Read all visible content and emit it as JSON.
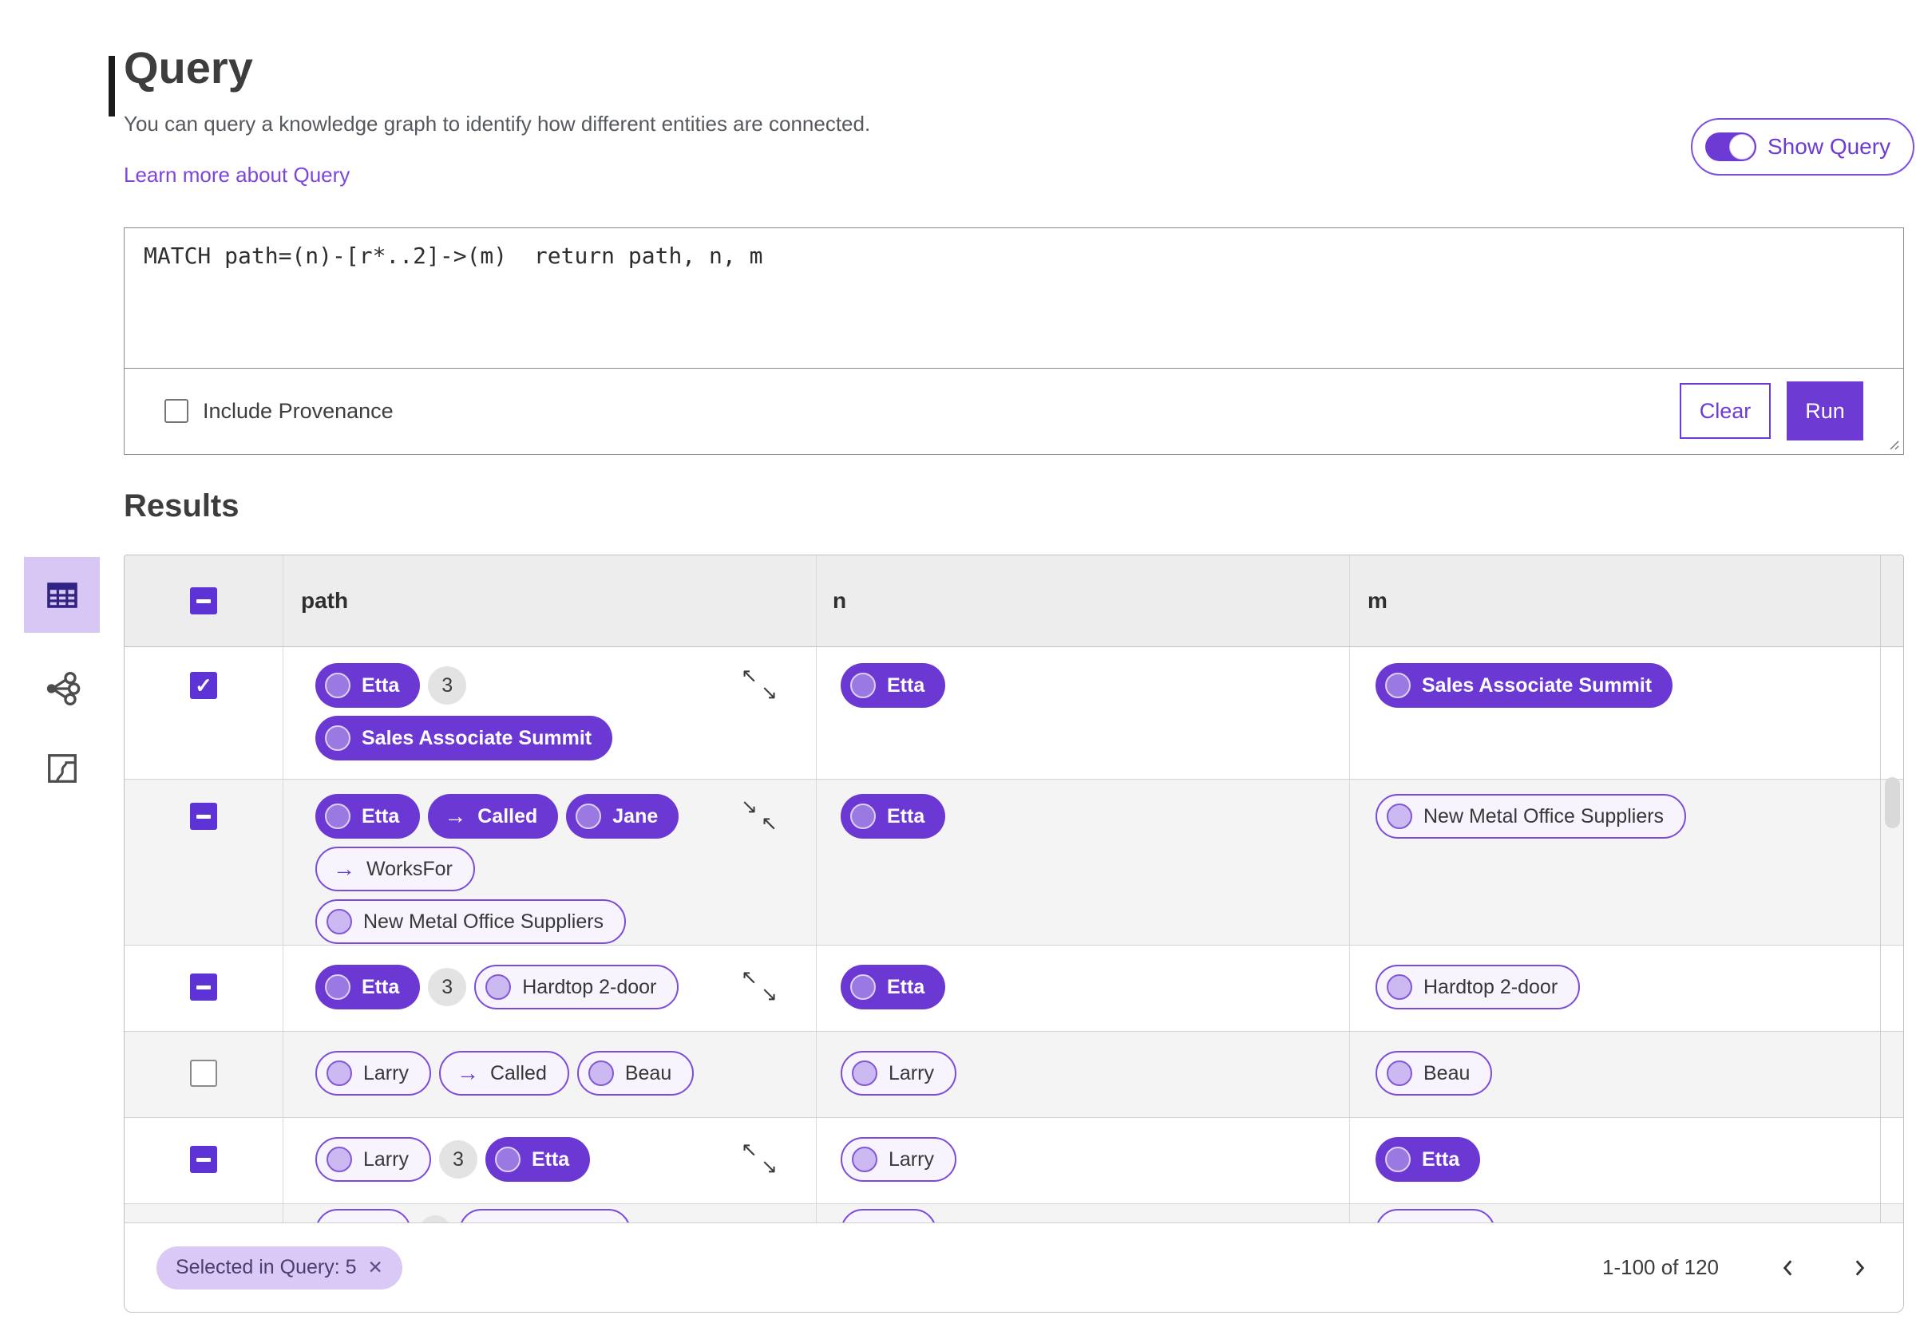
{
  "page": {
    "title": "Query",
    "description": "You can query a knowledge graph to identify how different entities are connected.",
    "learn_more_link": "Learn more about Query",
    "show_query_label": "Show Query",
    "show_query_on": true
  },
  "query_editor": {
    "query_text": "MATCH path=(n)-[r*..2]->(m)  return path, n, m",
    "include_provenance_label": "Include Provenance",
    "include_provenance_checked": false,
    "clear_button": "Clear",
    "run_button": "Run"
  },
  "results": {
    "heading": "Results",
    "view_rail": [
      {
        "id": "table-view",
        "selected": true
      },
      {
        "id": "graph-view",
        "selected": false
      },
      {
        "id": "map-view",
        "selected": false
      }
    ],
    "table": {
      "columns": [
        "path",
        "n",
        "m"
      ],
      "select_all_state": "indeterminate",
      "rows": [
        {
          "checkbox": "checked",
          "resize": "expand",
          "path": [
            [
              {
                "t": "node",
                "s": "filled",
                "label": "Etta"
              },
              {
                "t": "badge",
                "label": "3"
              }
            ],
            [
              {
                "t": "node",
                "s": "filled",
                "label": "Sales Associate Summit"
              }
            ]
          ],
          "n": [
            {
              "t": "node",
              "s": "filled",
              "label": "Etta"
            }
          ],
          "m": [
            {
              "t": "node",
              "s": "filled",
              "label": "Sales Associate Summit"
            }
          ]
        },
        {
          "checkbox": "indeterminate",
          "resize": "collapse",
          "path": [
            [
              {
                "t": "node",
                "s": "filled",
                "label": "Etta"
              },
              {
                "t": "edge",
                "s": "filled",
                "label": "Called"
              },
              {
                "t": "node",
                "s": "filled",
                "label": "Jane"
              }
            ],
            [
              {
                "t": "edge",
                "s": "outline",
                "label": "WorksFor"
              }
            ],
            [
              {
                "t": "node",
                "s": "outline",
                "label": "New Metal Office Suppliers"
              }
            ]
          ],
          "n": [
            {
              "t": "node",
              "s": "filled",
              "label": "Etta"
            }
          ],
          "m": [
            {
              "t": "node",
              "s": "outline",
              "label": "New Metal Office Suppliers"
            }
          ]
        },
        {
          "checkbox": "indeterminate",
          "resize": "expand",
          "path": [
            [
              {
                "t": "node",
                "s": "filled",
                "label": "Etta"
              },
              {
                "t": "badge",
                "label": "3"
              },
              {
                "t": "node",
                "s": "outline",
                "label": "Hardtop 2-door"
              }
            ]
          ],
          "n": [
            {
              "t": "node",
              "s": "filled",
              "label": "Etta"
            }
          ],
          "m": [
            {
              "t": "node",
              "s": "outline",
              "label": "Hardtop 2-door"
            }
          ]
        },
        {
          "checkbox": "unchecked",
          "resize": null,
          "path": [
            [
              {
                "t": "node",
                "s": "outline",
                "label": "Larry"
              },
              {
                "t": "edge",
                "s": "outline",
                "label": "Called"
              },
              {
                "t": "node",
                "s": "outline",
                "label": "Beau"
              }
            ]
          ],
          "n": [
            {
              "t": "node",
              "s": "outline",
              "label": "Larry"
            }
          ],
          "m": [
            {
              "t": "node",
              "s": "outline",
              "label": "Beau"
            }
          ]
        },
        {
          "checkbox": "indeterminate",
          "resize": "expand",
          "path": [
            [
              {
                "t": "node",
                "s": "outline",
                "label": "Larry"
              },
              {
                "t": "badge",
                "label": "3"
              },
              {
                "t": "node",
                "s": "filled",
                "label": "Etta"
              }
            ]
          ],
          "n": [
            {
              "t": "node",
              "s": "outline",
              "label": "Larry"
            }
          ],
          "m": [
            {
              "t": "node",
              "s": "filled",
              "label": "Etta"
            }
          ]
        },
        {
          "checkbox": "none",
          "resize": null,
          "partial": true,
          "path": [
            [
              {
                "t": "sk",
                "size": "s",
                "label": ""
              },
              {
                "t": "sk-badge",
                "label": ""
              },
              {
                "t": "sk",
                "size": "l",
                "label": ""
              }
            ]
          ],
          "n": [
            {
              "t": "sk",
              "size": "s",
              "label": ""
            }
          ],
          "m": [
            {
              "t": "sk",
              "size": "m",
              "label": ""
            }
          ]
        }
      ]
    },
    "footer": {
      "selected_chip": "Selected in Query: 5",
      "chip_dismiss": "✕",
      "page_info": "1-100 of 120"
    }
  },
  "colors": {
    "primary_purple": "#6c38d4",
    "outline_purple": "#7b4cdb",
    "rail_selected_bg": "#d8c6f5",
    "chip_bg": "#dac9f7",
    "header_bg": "#ededed",
    "alt_row_bg": "#f4f4f4"
  }
}
